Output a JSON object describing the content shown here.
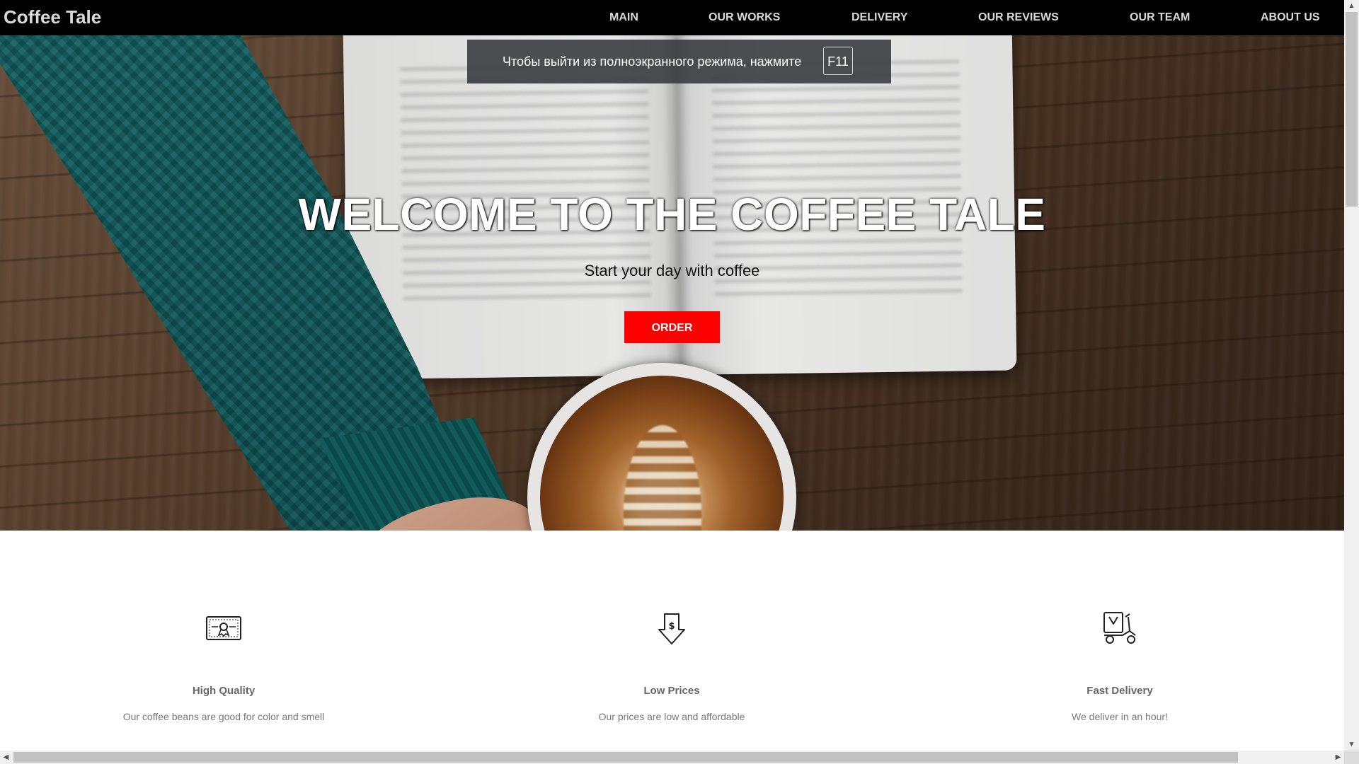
{
  "navbar": {
    "brand": "Coffee Tale",
    "items": [
      {
        "label": "MAIN"
      },
      {
        "label": "OUR WORKS"
      },
      {
        "label": "DELIVERY"
      },
      {
        "label": "OUR REVIEWS"
      },
      {
        "label": "OUR TEAM"
      },
      {
        "label": "ABOUT US"
      }
    ]
  },
  "toast": {
    "message": "Чтобы выйти из полноэкранного режима, нажмите",
    "key": "F11"
  },
  "hero": {
    "title": "WELCOME TO THE COFFEE TALE",
    "subtitle": "Start your day with coffee",
    "button_label": "ORDER"
  },
  "features": [
    {
      "icon": "certificate-icon",
      "title": "High Quality",
      "description": "Our coffee beans are good for color and smell"
    },
    {
      "icon": "price-down-icon",
      "title": "Low Prices",
      "description": "Our prices are low and affordable"
    },
    {
      "icon": "delivery-scooter-icon",
      "title": "Fast Delivery",
      "description": "We deliver in an hour!"
    }
  ],
  "colors": {
    "navbar_bg": "#000000",
    "nav_text": "#d9d9d9",
    "accent": "#ff0000",
    "feature_title": "#666666",
    "feature_text": "#777777"
  }
}
